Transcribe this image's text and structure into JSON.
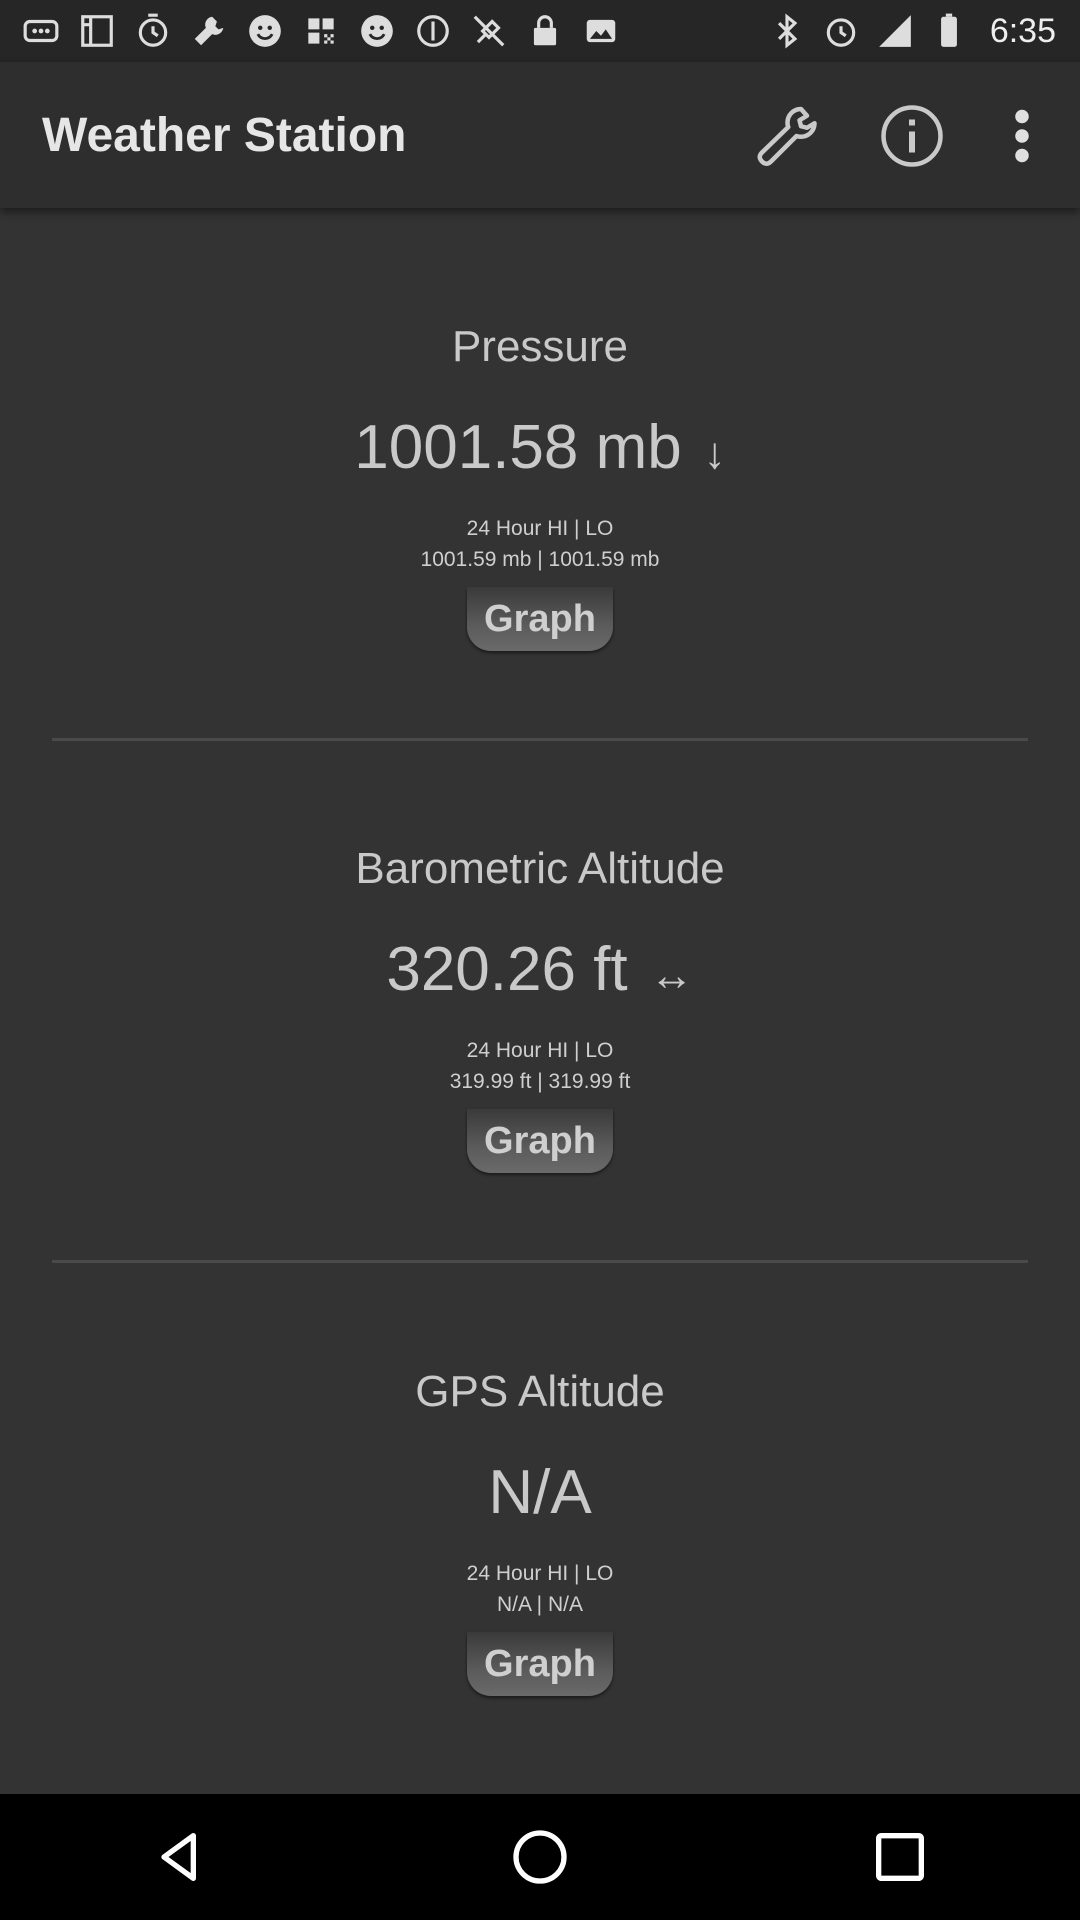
{
  "status_bar": {
    "time": "6:35",
    "left_icons": [
      "more-icon",
      "image-icon",
      "alarm-icon",
      "wrench-icon",
      "smiley-icon",
      "qr-icon",
      "smiley-icon",
      "disc-icon",
      "satellite-off-icon",
      "lock-icon",
      "image-icon"
    ],
    "right_icons": [
      "bluetooth-icon",
      "clock-icon",
      "signal-icon",
      "battery-icon"
    ]
  },
  "app_bar": {
    "title": "Weather Station",
    "actions": [
      "wrench-icon",
      "info-icon",
      "more-vert-icon"
    ]
  },
  "sections": [
    {
      "title": "Pressure",
      "value": "1001.58 mb",
      "trend": "↓",
      "hilo_label": "24 Hour HI | LO",
      "hilo_value": "1001.59 mb | 1001.59 mb",
      "button": "Graph"
    },
    {
      "title": "Barometric Altitude",
      "value": "320.26 ft",
      "trend": "↔",
      "hilo_label": "24 Hour HI | LO",
      "hilo_value": "319.99 ft | 319.99 ft",
      "button": "Graph"
    },
    {
      "title": "GPS Altitude",
      "value": "N/A",
      "trend": "",
      "hilo_label": "24 Hour HI | LO",
      "hilo_value": "N/A | N/A",
      "button": "Graph"
    }
  ],
  "nav_bar": [
    "back-icon",
    "home-icon",
    "recents-icon"
  ]
}
